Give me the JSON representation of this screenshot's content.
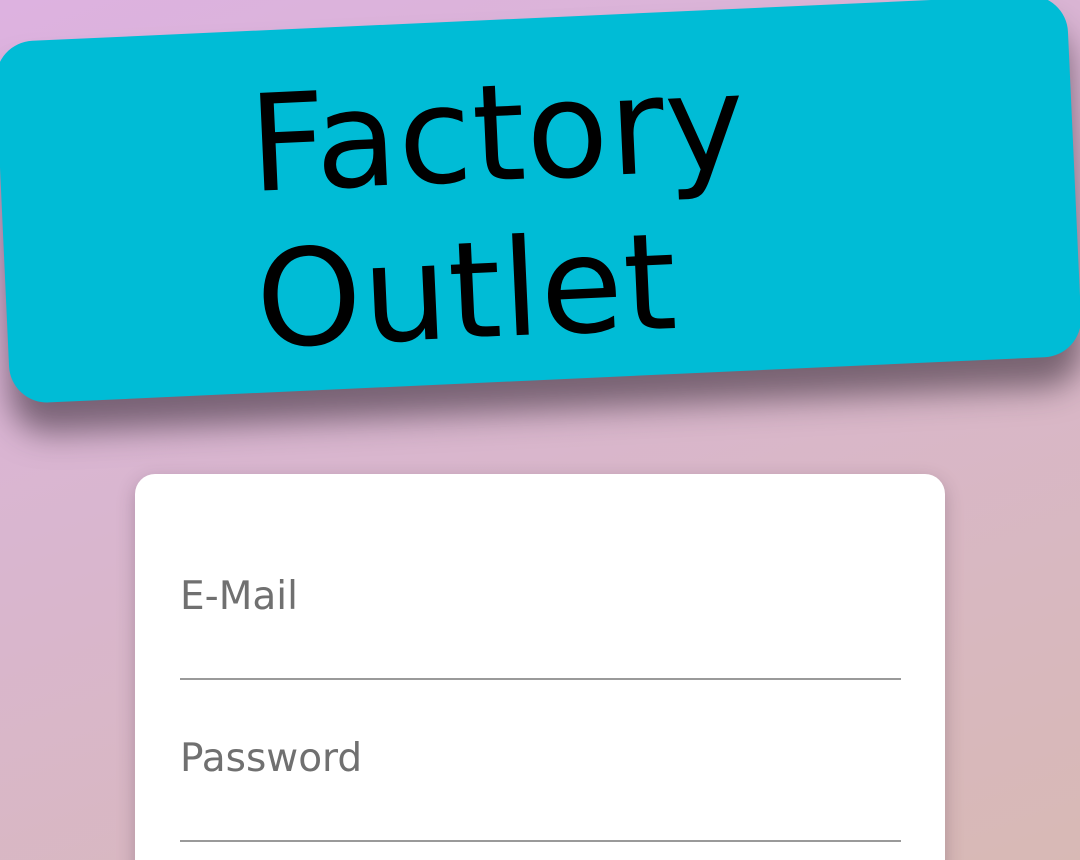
{
  "banner": {
    "title_line1": "Factory",
    "title_line2": "Outlet",
    "background_color": "#00bcd6"
  },
  "login_form": {
    "email_label": "E-Mail",
    "password_label": "Password"
  }
}
